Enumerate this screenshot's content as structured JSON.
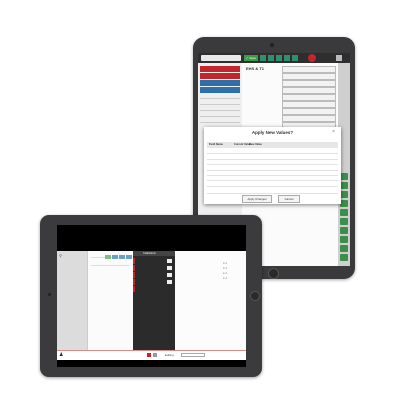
{
  "back_tablet": {
    "toolbar": {
      "green_button": "✓ Save"
    },
    "sidebar_items": [
      {
        "label": "",
        "color": "#c0262b"
      },
      {
        "label": "",
        "color": "#c0262b"
      },
      {
        "label": "",
        "color": "#2f6fa8"
      },
      {
        "label": "",
        "color": "#2f6fa8"
      }
    ],
    "main_heading": "EHS & T1",
    "dialog": {
      "title": "Apply New Values?",
      "close": "×",
      "columns": [
        "Field Name",
        "Current Value",
        "New Value"
      ],
      "rows": [
        [
          "",
          "",
          ""
        ],
        [
          "",
          "",
          ""
        ],
        [
          "",
          "",
          ""
        ],
        [
          "",
          "",
          ""
        ],
        [
          "",
          "",
          ""
        ],
        [
          "",
          "",
          ""
        ],
        [
          "",
          "",
          ""
        ],
        [
          "",
          "",
          ""
        ]
      ],
      "apply_label": "Apply Changes",
      "cancel_label": "Cancel"
    }
  },
  "front_tablet": {
    "dark_panel_title": "Collections",
    "bottom_label": "Editing",
    "select_value": "",
    "accent_color": "#c0262b"
  }
}
